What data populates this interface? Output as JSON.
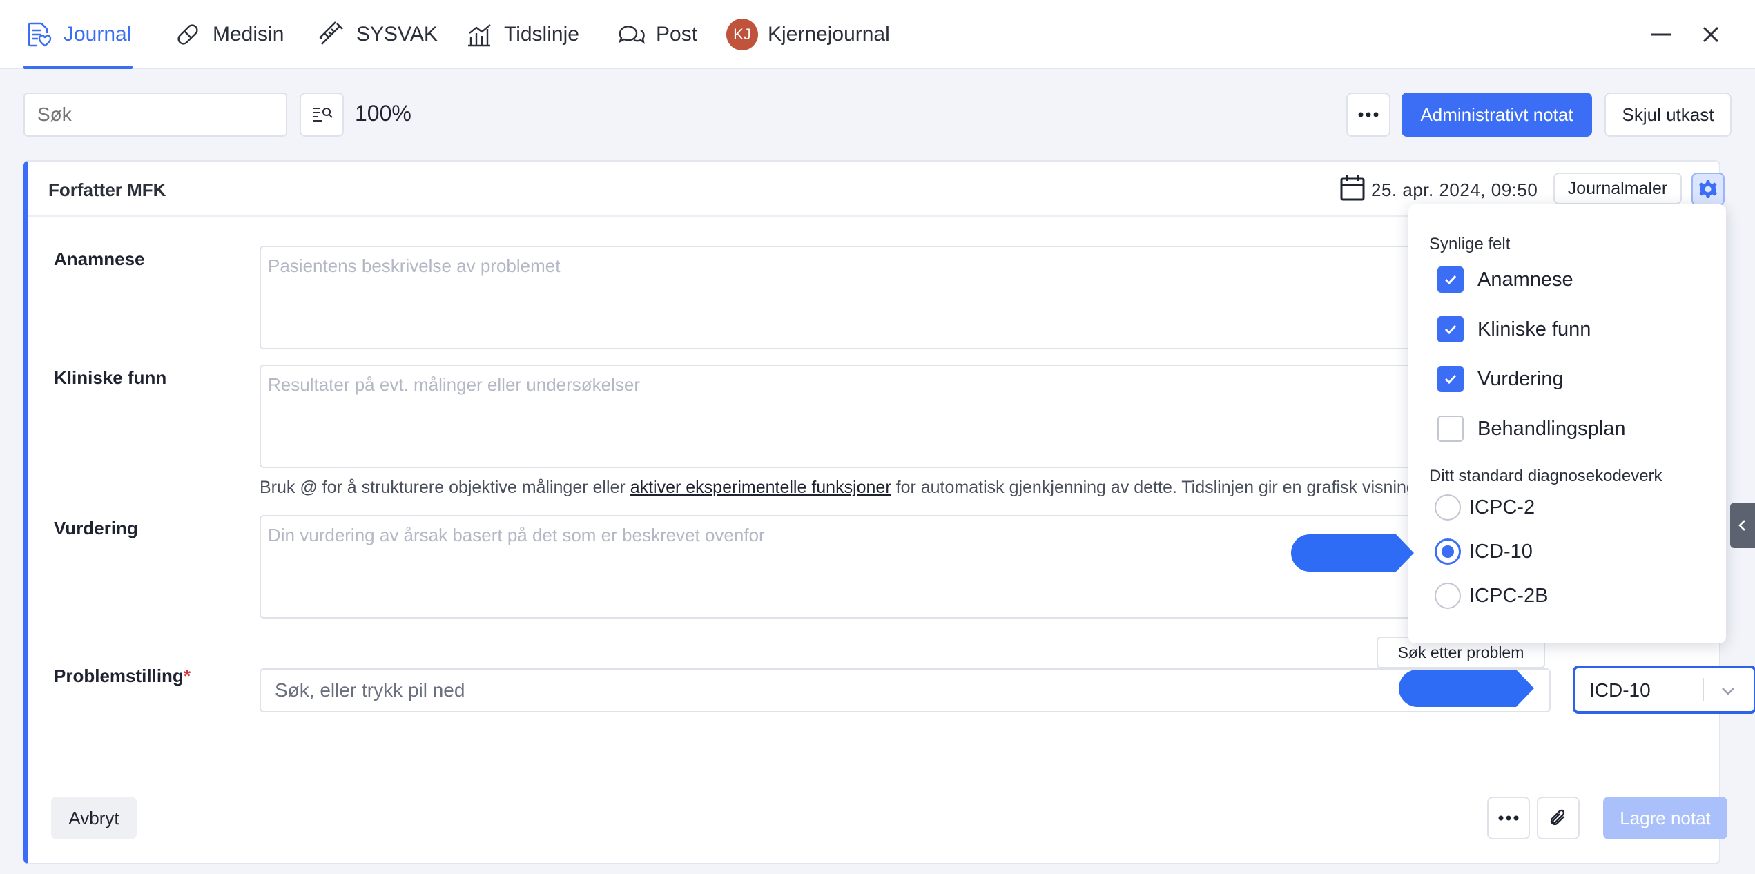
{
  "tabs": [
    {
      "label": "Journal",
      "icon": "journal-icon",
      "active": true
    },
    {
      "label": "Medisin",
      "icon": "pill-icon"
    },
    {
      "label": "SYSVAK",
      "icon": "syringe-icon"
    },
    {
      "label": "Tidslinje",
      "icon": "chart-icon"
    },
    {
      "label": "Post",
      "icon": "chat-icon"
    },
    {
      "label": "Kjernejournal",
      "avatar": "KJ"
    }
  ],
  "toolbar": {
    "search_placeholder": "Søk",
    "zoom": "100%",
    "admin_note_label": "Administrativt notat",
    "hide_draft_label": "Skjul utkast"
  },
  "note": {
    "author": "Forfatter MFK",
    "date": "25. apr. 2024, 09:50",
    "templates_label": "Journalmaler",
    "fields": {
      "anamnese_label": "Anamnese",
      "anamnese_placeholder": "Pasientens beskrivelse av problemet",
      "kliniske_label": "Kliniske funn",
      "kliniske_placeholder": "Resultater på evt. målinger eller undersøkelser",
      "hint_before": "Bruk @ for å strukturere objektive målinger eller ",
      "hint_link": "aktiver eksperimentelle funksjoner",
      "hint_after": " for automatisk gjenkjenning av dette. Tidslinjen gir en grafisk visning",
      "vurdering_label": "Vurdering",
      "vurdering_placeholder": "Din vurdering av årsak basert på det som er beskrevet ovenfor",
      "problem_label": "Problemstilling",
      "problem_required": "*",
      "problem_placeholder": "Søk, eller trykk pil ned",
      "problem_tooltip": "Søk etter problem",
      "code_select_value": "ICD-10"
    },
    "footer": {
      "cancel_label": "Avbryt",
      "save_label": "Lagre notat"
    }
  },
  "settings_popup": {
    "visible_fields_title": "Synlige felt",
    "visible_fields": [
      {
        "label": "Anamnese",
        "checked": true
      },
      {
        "label": "Kliniske funn",
        "checked": true
      },
      {
        "label": "Vurdering",
        "checked": true
      },
      {
        "label": "Behandlingsplan",
        "checked": false
      }
    ],
    "code_title": "Ditt standard diagnosekodeverk",
    "codes": [
      {
        "label": "ICPC-2",
        "selected": false
      },
      {
        "label": "ICD-10",
        "selected": true
      },
      {
        "label": "ICPC-2B",
        "selected": false
      }
    ]
  },
  "colors": {
    "accent": "#3b6ef5",
    "pointer": "#2f6cf5",
    "required": "#d3333a",
    "avatar": "#c0533c"
  }
}
